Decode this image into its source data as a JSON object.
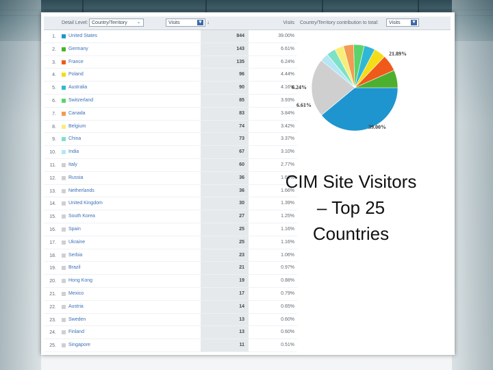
{
  "header": {
    "detail_level_label": "Detail Level:",
    "dimension_select": "Country/Territory",
    "metric_select": "Visits",
    "visits_column": "Visits",
    "pie_header_label": "Country/Territory contribution to total:",
    "pie_metric_select": "Visits"
  },
  "rows": [
    {
      "num": "1.",
      "country": "United States",
      "visits": "844",
      "pct": "39.00%",
      "color": "#1f95cf"
    },
    {
      "num": "2.",
      "country": "Germany",
      "visits": "143",
      "pct": "6.61%",
      "color": "#4caf2e"
    },
    {
      "num": "3.",
      "country": "France",
      "visits": "135",
      "pct": "6.24%",
      "color": "#ef5a1a"
    },
    {
      "num": "4.",
      "country": "Poland",
      "visits": "96",
      "pct": "4.44%",
      "color": "#f4dd17"
    },
    {
      "num": "5.",
      "country": "Australia",
      "visits": "90",
      "pct": "4.16%",
      "color": "#31b7d6"
    },
    {
      "num": "6.",
      "country": "Switzerland",
      "visits": "85",
      "pct": "3.93%",
      "color": "#5bd36a"
    },
    {
      "num": "7.",
      "country": "Canada",
      "visits": "83",
      "pct": "3.84%",
      "color": "#f39a55"
    },
    {
      "num": "8.",
      "country": "Belgium",
      "visits": "74",
      "pct": "3.42%",
      "color": "#f7ee79"
    },
    {
      "num": "9.",
      "country": "China",
      "visits": "73",
      "pct": "3.37%",
      "color": "#7de1c6"
    },
    {
      "num": "10.",
      "country": "India",
      "visits": "67",
      "pct": "3.10%",
      "color": "#b5e6f5"
    },
    {
      "num": "11.",
      "country": "Italy",
      "visits": "60",
      "pct": "2.77%",
      "color": "#cfcfcf"
    },
    {
      "num": "12.",
      "country": "Russia",
      "visits": "36",
      "pct": "1.66%",
      "color": "#cfcfcf"
    },
    {
      "num": "13.",
      "country": "Netherlands",
      "visits": "36",
      "pct": "1.66%",
      "color": "#cfcfcf"
    },
    {
      "num": "14.",
      "country": "United Kingdom",
      "visits": "30",
      "pct": "1.39%",
      "color": "#cfcfcf"
    },
    {
      "num": "15.",
      "country": "South Korea",
      "visits": "27",
      "pct": "1.25%",
      "color": "#cfcfcf"
    },
    {
      "num": "16.",
      "country": "Spain",
      "visits": "25",
      "pct": "1.16%",
      "color": "#cfcfcf"
    },
    {
      "num": "17.",
      "country": "Ukraine",
      "visits": "25",
      "pct": "1.16%",
      "color": "#cfcfcf"
    },
    {
      "num": "18.",
      "country": "Serbia",
      "visits": "23",
      "pct": "1.06%",
      "color": "#cfcfcf"
    },
    {
      "num": "19.",
      "country": "Brazil",
      "visits": "21",
      "pct": "0.97%",
      "color": "#cfcfcf"
    },
    {
      "num": "20.",
      "country": "Hong Kong",
      "visits": "19",
      "pct": "0.88%",
      "color": "#cfcfcf"
    },
    {
      "num": "21.",
      "country": "Mexico",
      "visits": "17",
      "pct": "0.79%",
      "color": "#cfcfcf"
    },
    {
      "num": "22.",
      "country": "Austria",
      "visits": "14",
      "pct": "0.65%",
      "color": "#cfcfcf"
    },
    {
      "num": "23.",
      "country": "Sweden",
      "visits": "13",
      "pct": "0.60%",
      "color": "#cfcfcf"
    },
    {
      "num": "24.",
      "country": "Finland",
      "visits": "13",
      "pct": "0.60%",
      "color": "#cfcfcf"
    },
    {
      "num": "25.",
      "country": "Singapore",
      "visits": "11",
      "pct": "0.51%",
      "color": "#cfcfcf"
    }
  ],
  "pie": {
    "slices": [
      {
        "name": "United States",
        "value": 39.0,
        "color": "#1f95cf"
      },
      {
        "name": "Germany",
        "value": 6.61,
        "color": "#4caf2e"
      },
      {
        "name": "France",
        "value": 6.24,
        "color": "#ef5a1a"
      },
      {
        "name": "Poland",
        "value": 4.44,
        "color": "#f4dd17"
      },
      {
        "name": "Australia",
        "value": 4.16,
        "color": "#31b7d6"
      },
      {
        "name": "Switzerland",
        "value": 3.93,
        "color": "#5bd36a"
      },
      {
        "name": "Canada",
        "value": 3.84,
        "color": "#f39a55"
      },
      {
        "name": "Belgium",
        "value": 3.42,
        "color": "#f7ee79"
      },
      {
        "name": "China",
        "value": 3.37,
        "color": "#7de1c6"
      },
      {
        "name": "India",
        "value": 3.1,
        "color": "#b5e6f5"
      },
      {
        "name": "Other",
        "value": 21.89,
        "color": "#cfcfcf"
      }
    ],
    "labels": {
      "us": "39.00%",
      "germany": "6.61%",
      "france": "6.24%",
      "other": "21.89%"
    }
  },
  "slide_title": {
    "line1": "CIM Site Visitors",
    "line2": "– Top 25",
    "line3": "Countries"
  }
}
